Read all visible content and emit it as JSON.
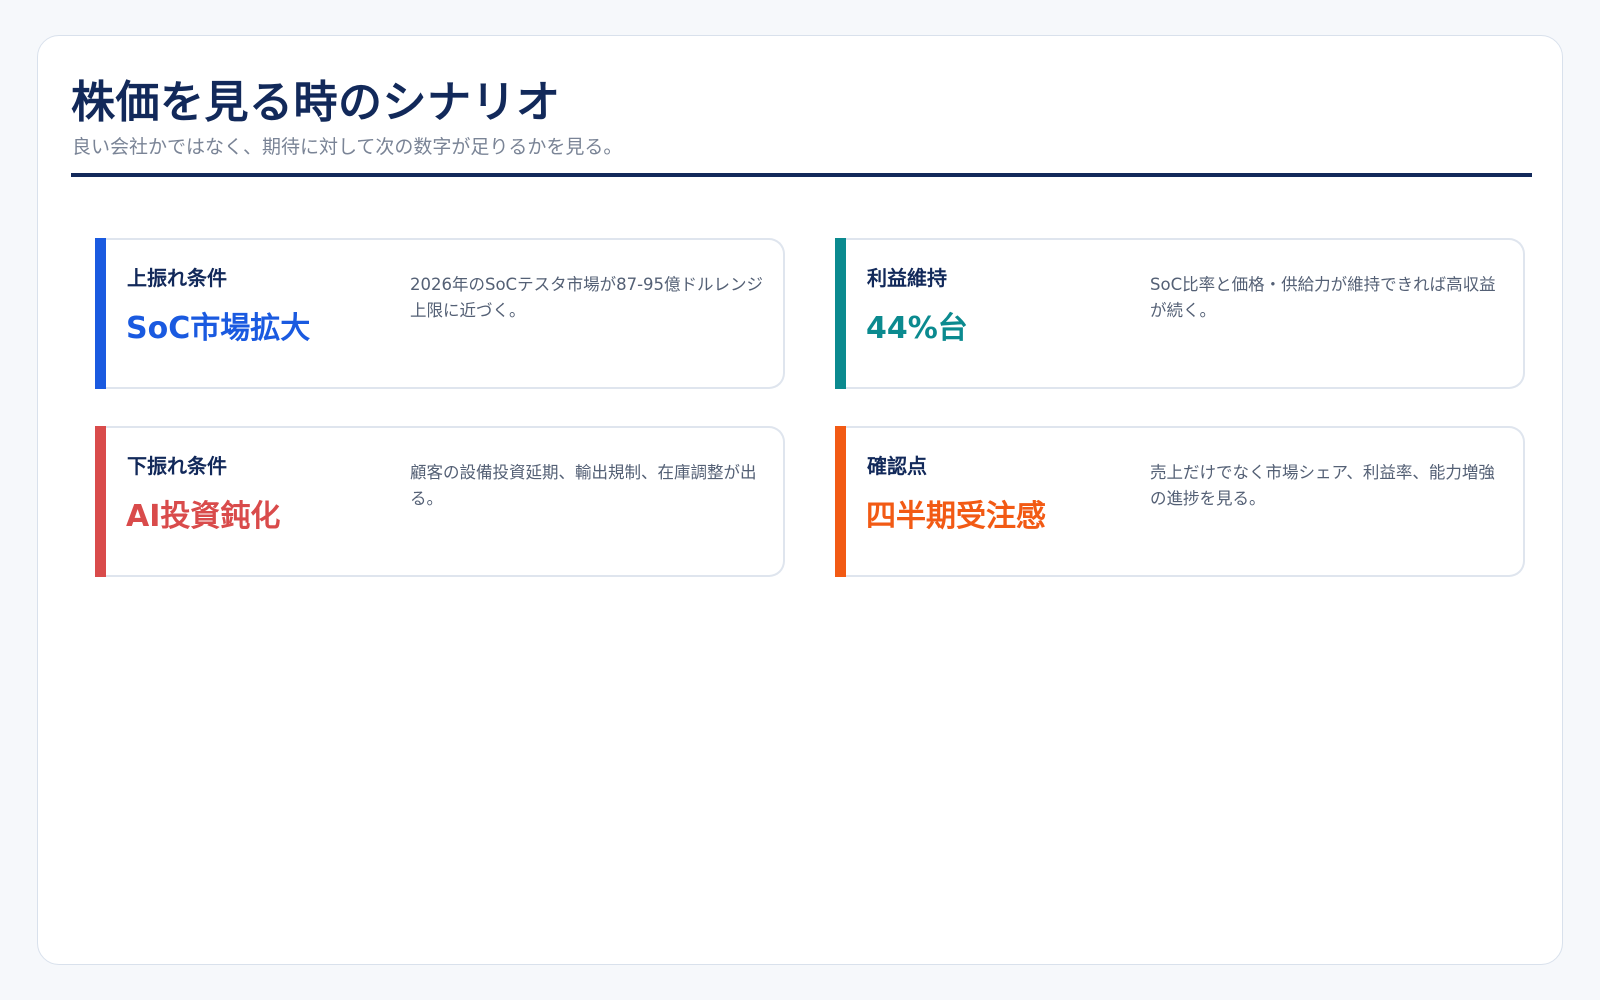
{
  "page": {
    "title": "株価を見る時のシナリオ",
    "subtitle": "良い会社かではなく、期待に対して次の数字が足りるかを見る。"
  },
  "cards": [
    {
      "label": "上振れ条件",
      "value": "SoC市場拡大",
      "description": "2026年のSoCテスタ市場が87-95億ドルレンジ上限に近づく。",
      "accent_color": "#1a5ae0"
    },
    {
      "label": "利益維持",
      "value": "44%台",
      "description": "SoC比率と価格・供給力が維持できれば高収益が続く。",
      "accent_color": "#0b8a8f"
    },
    {
      "label": "下振れ条件",
      "value": "AI投資鈍化",
      "description": "顧客の設備投資延期、輸出規制、在庫調整が出る。",
      "accent_color": "#d94b4b"
    },
    {
      "label": "確認点",
      "value": "四半期受注感",
      "description": "売上だけでなく市場シェア、利益率、能力増強の進捗を見る。",
      "accent_color": "#f25a14"
    }
  ]
}
